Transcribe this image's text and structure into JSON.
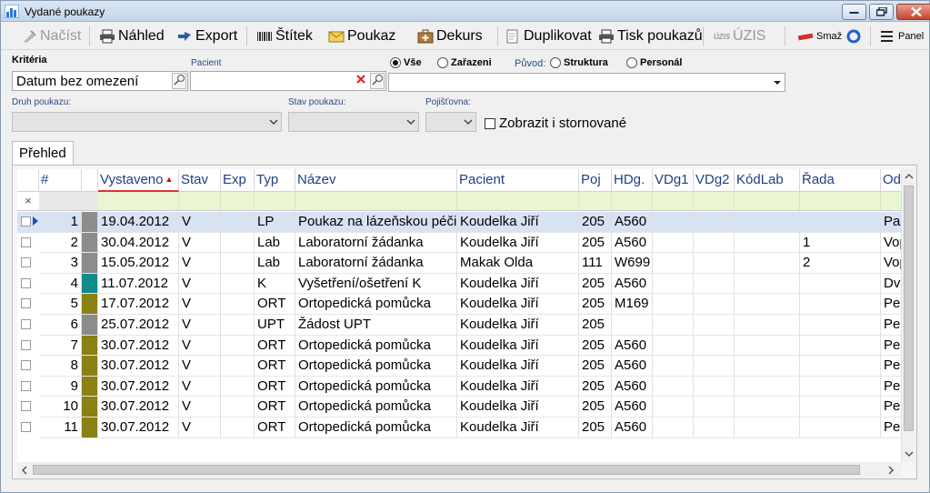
{
  "window": {
    "title": "Vydané poukazy"
  },
  "toolbar": {
    "nacist": "Načíst",
    "nahled": "Náhled",
    "export": "Export",
    "stitek": "Štítek",
    "poukaz": "Poukaz",
    "dekurs": "Dekurs",
    "duplikovat": "Duplikovat",
    "tisk": "Tisk poukazů",
    "uzis": "ÚZIS",
    "smaz": "Smaž",
    "panel": "Panel"
  },
  "filters": {
    "kriteria_label": "Kritéria",
    "kriteria_value": "Datum bez omezení",
    "pacient_label": "Pacient",
    "pacient_value": "",
    "radio_vse": "Vše",
    "radio_zarazeni": "Zařazeni",
    "puvod_label": "Původ:",
    "radio_struktura": "Struktura",
    "radio_personal": "Personál",
    "druh_label": "Druh poukazu:",
    "stav_label": "Stav poukazu:",
    "pojistovna_label": "Pojišťovna:",
    "storno_label": "Zobrazit i stornované"
  },
  "tabs": {
    "prehled": "Přehled"
  },
  "grid": {
    "columns": [
      "#",
      "",
      "Vystaveno",
      "Stav",
      "Exp",
      "Typ",
      "Název",
      "Pacient",
      "Poj",
      "HDg.",
      "VDg1",
      "VDg2",
      "KódLab",
      "Řada",
      "Odes"
    ],
    "rows": [
      {
        "n": "1",
        "color": "#8c8c8c",
        "date": "19.04.2012",
        "stav": "V",
        "exp": "",
        "typ": "LP",
        "nazev": "Poukaz na lázeňskou péči",
        "pacient": "Koudelka Jiří",
        "poj": "205",
        "hdg": "A560",
        "vdg1": "",
        "vdg2": "",
        "kod": "",
        "rada": "",
        "odes": "Pac"
      },
      {
        "n": "2",
        "color": "#8c8c8c",
        "date": "30.04.2012",
        "stav": "V",
        "exp": "",
        "typ": "Lab",
        "nazev": "Laboratorní žádanka",
        "pacient": "Koudelka Jiří",
        "poj": "205",
        "hdg": "A560",
        "vdg1": "",
        "vdg2": "",
        "kod": "",
        "rada": "1",
        "odes": "Vop"
      },
      {
        "n": "3",
        "color": "#8c8c8c",
        "date": "15.05.2012",
        "stav": "V",
        "exp": "",
        "typ": "Lab",
        "nazev": "Laboratorní žádanka",
        "pacient": "Makak Olda",
        "poj": "111",
        "hdg": "W699",
        "vdg1": "",
        "vdg2": "",
        "kod": "",
        "rada": "2",
        "odes": "Vop"
      },
      {
        "n": "4",
        "color": "#138a8a",
        "date": "11.07.2012",
        "stav": "V",
        "exp": "",
        "typ": "K",
        "nazev": "Vyšetření/ošetření K",
        "pacient": "Koudelka Jiří",
        "poj": "205",
        "hdg": "A560",
        "vdg1": "",
        "vdg2": "",
        "kod": "",
        "rada": "",
        "odes": "Dvo"
      },
      {
        "n": "5",
        "color": "#8a8014",
        "date": "17.07.2012",
        "stav": "V",
        "exp": "",
        "typ": "ORT",
        "nazev": "Ortopedická pomůcka",
        "pacient": "Koudelka Jiří",
        "poj": "205",
        "hdg": "M169",
        "vdg1": "",
        "vdg2": "",
        "kod": "",
        "rada": "",
        "odes": "Peo"
      },
      {
        "n": "6",
        "color": "#8c8c8c",
        "date": "25.07.2012",
        "stav": "V",
        "exp": "",
        "typ": "UPT",
        "nazev": "Žádost UPT",
        "pacient": "Koudelka Jiří",
        "poj": "205",
        "hdg": "",
        "vdg1": "",
        "vdg2": "",
        "kod": "",
        "rada": "",
        "odes": "Peo"
      },
      {
        "n": "7",
        "color": "#8a8014",
        "date": "30.07.2012",
        "stav": "V",
        "exp": "",
        "typ": "ORT",
        "nazev": "Ortopedická pomůcka",
        "pacient": "Koudelka Jiří",
        "poj": "205",
        "hdg": "A560",
        "vdg1": "",
        "vdg2": "",
        "kod": "",
        "rada": "",
        "odes": "Peo"
      },
      {
        "n": "8",
        "color": "#8a8014",
        "date": "30.07.2012",
        "stav": "V",
        "exp": "",
        "typ": "ORT",
        "nazev": "Ortopedická pomůcka",
        "pacient": "Koudelka Jiří",
        "poj": "205",
        "hdg": "A560",
        "vdg1": "",
        "vdg2": "",
        "kod": "",
        "rada": "",
        "odes": "Peo"
      },
      {
        "n": "9",
        "color": "#8a8014",
        "date": "30.07.2012",
        "stav": "V",
        "exp": "",
        "typ": "ORT",
        "nazev": "Ortopedická pomůcka",
        "pacient": "Koudelka Jiří",
        "poj": "205",
        "hdg": "A560",
        "vdg1": "",
        "vdg2": "",
        "kod": "",
        "rada": "",
        "odes": "Peo"
      },
      {
        "n": "10",
        "color": "#8a8014",
        "date": "30.07.2012",
        "stav": "V",
        "exp": "",
        "typ": "ORT",
        "nazev": "Ortopedická pomůcka",
        "pacient": "Koudelka Jiří",
        "poj": "205",
        "hdg": "A560",
        "vdg1": "",
        "vdg2": "",
        "kod": "",
        "rada": "",
        "odes": "Peo"
      },
      {
        "n": "11",
        "color": "#8a8014",
        "date": "30.07.2012",
        "stav": "V",
        "exp": "",
        "typ": "ORT",
        "nazev": "Ortopedická pomůcka",
        "pacient": "Koudelka Jiří",
        "poj": "205",
        "hdg": "A560",
        "vdg1": "",
        "vdg2": "",
        "kod": "",
        "rada": "",
        "odes": "Peo"
      }
    ],
    "selected_row": 0,
    "sorted_column": "Vystaveno"
  }
}
